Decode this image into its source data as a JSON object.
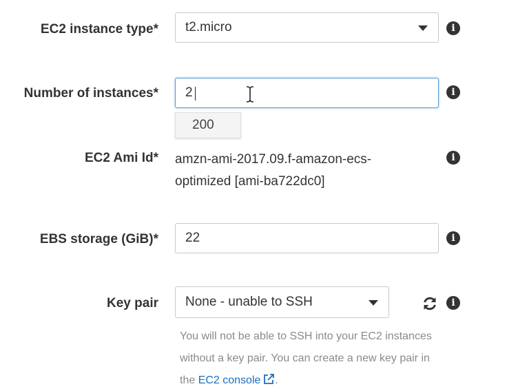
{
  "fields": {
    "instance_type": {
      "label": "EC2 instance type*",
      "value": "t2.micro"
    },
    "num_instances": {
      "label": "Number of instances*",
      "value": "2",
      "suggestion": "200"
    },
    "ami": {
      "label": "EC2 Ami Id*",
      "value_line1": "amzn-ami-2017.09.f-amazon-ecs-",
      "value_line2": "optimized [ami-ba722dc0]"
    },
    "ebs": {
      "label": "EBS storage (GiB)*",
      "value": "22"
    },
    "key_pair": {
      "label": "Key pair",
      "value": "None - unable to SSH",
      "help_prefix": "You will not be able to SSH into your EC2 instances without a key pair. You can create a new key pair in the ",
      "help_link": "EC2 console",
      "help_suffix": "."
    }
  },
  "icons": {
    "info": "i",
    "info_icon_name": "info-icon",
    "refresh_icon_name": "refresh-icon",
    "external_link_icon_name": "external-link-icon"
  },
  "colors": {
    "link": "#1a6fc2",
    "focus_border": "#5b9bd5",
    "help_text": "#8a8a8a"
  }
}
